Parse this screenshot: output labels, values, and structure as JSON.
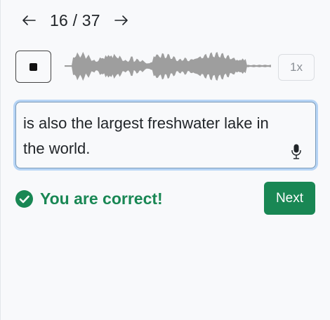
{
  "pager": {
    "current": "16",
    "separator": "/",
    "total": "37",
    "text": "16 / 37",
    "prev_icon": "arrow-left-icon",
    "next_icon": "arrow-right-icon"
  },
  "player": {
    "stop_icon": "stop-icon",
    "speed_label": "1x",
    "waveform_color": "#9e9e9e"
  },
  "answer": {
    "text": "is also the largest freshwater lake in the world.",
    "mic_icon": "microphone-icon"
  },
  "feedback": {
    "icon": "check-circle-icon",
    "message": "You are correct!",
    "color": "#198754"
  },
  "actions": {
    "next_label": "Next",
    "next_color": "#198754"
  }
}
